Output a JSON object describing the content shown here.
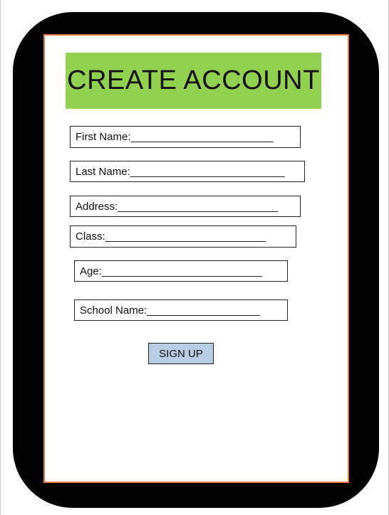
{
  "title": "CREATE ACCOUNT",
  "form": {
    "fields": [
      {
        "label": "First Name:",
        "line": "________________________"
      },
      {
        "label": "Last Name:",
        "line": "__________________________"
      },
      {
        "label": "Address:",
        "line": "___________________________"
      },
      {
        "label": "Class:",
        "line": "___________________________"
      },
      {
        "label": "Age:",
        "line": "___________________________"
      },
      {
        "label": "School Name:",
        "line": "___________________"
      }
    ],
    "submit_label": "SIGN UP"
  },
  "colors": {
    "frame": "#000000",
    "screen_border": "#e8793a",
    "title_background": "#92d050",
    "button_background": "#b8cce4"
  }
}
